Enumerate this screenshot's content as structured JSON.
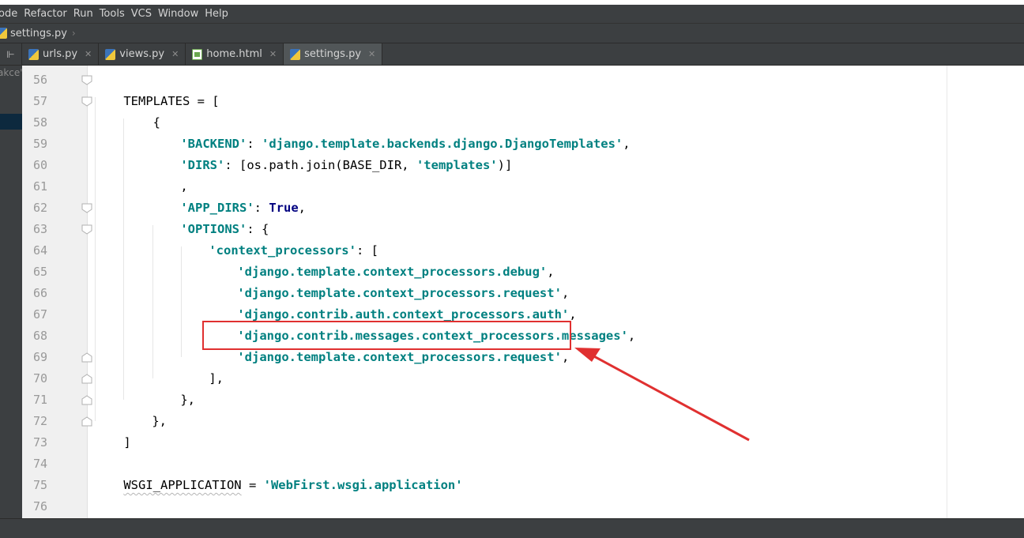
{
  "menu": {
    "items": [
      "ode",
      "Refactor",
      "Run",
      "Tools",
      "VCS",
      "Window",
      "Help"
    ]
  },
  "navbar": {
    "breadcrumb": "settings.py"
  },
  "tabs": [
    {
      "label": "urls.py",
      "icon": "python-file-icon",
      "active": false
    },
    {
      "label": "views.py",
      "icon": "python-file-icon",
      "active": false
    },
    {
      "label": "home.html",
      "icon": "html-file-icon",
      "active": false
    },
    {
      "label": "settings.py",
      "icon": "python-file-icon",
      "active": true
    }
  ],
  "left_panel": {
    "truncated_text": "akce'"
  },
  "editor": {
    "line_numbers": [
      "56",
      "57",
      "58",
      "59",
      "60",
      "61",
      "62",
      "63",
      "64",
      "65",
      "66",
      "67",
      "68",
      "69",
      "70",
      "71",
      "72",
      "73",
      "74",
      "75",
      "76"
    ],
    "lines": {
      "l56": "TEMPLATES = [",
      "l57": "    {",
      "l58_key": "'BACKEND'",
      "l58_sep": ": ",
      "l58_val": "'django.template.backends.django.DjangoTemplates'",
      "l58_end": ",",
      "l59_key": "'DIRS'",
      "l59_mid": ": [os.path.join(BASE_DIR, ",
      "l59_val": "'templates'",
      "l59_end": ")]",
      "l60": ",",
      "l61_key": "'APP_DIRS'",
      "l61_sep": ": ",
      "l61_val": "True",
      "l61_end": ",",
      "l62_key": "'OPTIONS'",
      "l62_end": ": {",
      "l63_key": "'context_processors'",
      "l63_end": ": [",
      "l64_val": "'django.template.context_processors.debug'",
      "l65_val": "'django.template.context_processors.request'",
      "l66_val": "'django.contrib.auth.context_processors.auth'",
      "l67_val": "'django.contrib.messages.context_processors.messages'",
      "l68_val": "'django.template.context_processors.request'",
      "comma": ",",
      "l69": "],",
      "l70": "},",
      "l71": "},",
      "l72": "]",
      "l74_name": "WSGI_APPLICATION",
      "l74_sep": " = ",
      "l74_val": "'WebFirst.wsgi.application'"
    }
  },
  "annotation": {
    "box_color": "#e03030",
    "arrow_color": "#e03030"
  }
}
